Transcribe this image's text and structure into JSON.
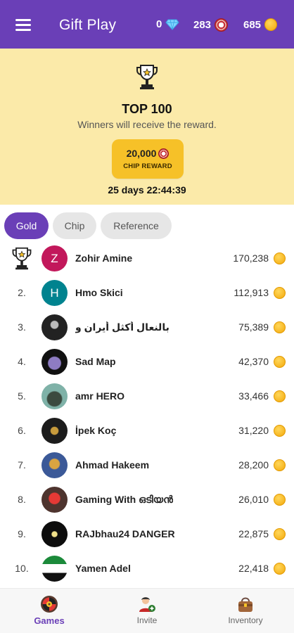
{
  "header": {
    "title": "Gift Play",
    "diamonds": "0",
    "chips": "283",
    "coins": "685"
  },
  "banner": {
    "title": "TOP 100",
    "subtitle": "Winners will receive the reward.",
    "reward_amount": "20,000",
    "reward_label": "CHIP REWARD",
    "countdown": "25 days 22:44:39"
  },
  "tabs": [
    {
      "label": "Gold",
      "active": true
    },
    {
      "label": "Chip",
      "active": false
    },
    {
      "label": "Reference",
      "active": false
    }
  ],
  "leaders": [
    {
      "rank": "",
      "name": "Zohir Amine",
      "score": "170,238",
      "initial": "Z"
    },
    {
      "rank": "2.",
      "name": "Hmo Skici",
      "score": "112,913",
      "initial": "H"
    },
    {
      "rank": "3.",
      "name": "بالنعال أكثل أيران و",
      "score": "75,389",
      "initial": ""
    },
    {
      "rank": "4.",
      "name": "Sad Map",
      "score": "42,370",
      "initial": ""
    },
    {
      "rank": "5.",
      "name": "amr HERO",
      "score": "33,466",
      "initial": ""
    },
    {
      "rank": "6.",
      "name": "İpek Koç",
      "score": "31,220",
      "initial": ""
    },
    {
      "rank": "7.",
      "name": "Ahmad Hakeem",
      "score": "28,200",
      "initial": ""
    },
    {
      "rank": "8.",
      "name": "Gaming With ഒടിയൻ",
      "score": "26,010",
      "initial": ""
    },
    {
      "rank": "9.",
      "name": "RAJbhau24 DANGER",
      "score": "22,875",
      "initial": ""
    },
    {
      "rank": "10.",
      "name": "Yamen Adel",
      "score": "22,418",
      "initial": ""
    }
  ],
  "avatar_colors": {
    "zohir": "#c2185b",
    "hmo": "#00838f"
  },
  "bottom_nav": {
    "games": "Games",
    "invite": "Invite",
    "inventory": "Inventory"
  },
  "colors": {
    "brand_purple": "#6a3fb7",
    "banner_bg": "#fbeaa9",
    "reward_yellow": "#f6c128",
    "coin_gold": "#f3a90c"
  },
  "icons": {
    "menu": "hamburger-menu-icon",
    "diamond": "diamond-icon",
    "chip": "casino-chip-icon",
    "coin": "gold-coin-icon",
    "trophy": "trophy-icon",
    "games": "roulette-wheel-icon",
    "invite": "person-add-icon",
    "inventory": "bag-icon"
  }
}
